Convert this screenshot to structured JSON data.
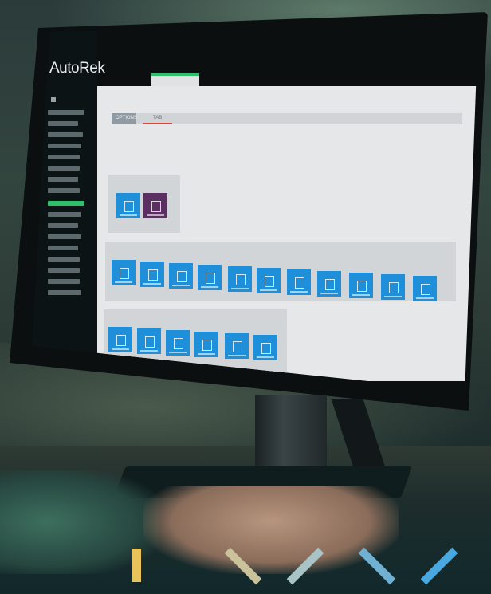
{
  "photo": {
    "description_colors": {
      "screen_bg": "#e5e7e8",
      "sidebar_bg": "#0c1314",
      "accent_green": "#2dbf6a",
      "tile_blue": "#1e8fd8",
      "tile_purple": "#5b2f62"
    }
  },
  "app": {
    "logo_text": "AutoRek",
    "toolbar": {
      "button_label": "OPTIONS",
      "tab_label": "TAB"
    }
  },
  "decor": {
    "stripe_colors": [
      "#e8c25b",
      "#c9c29a",
      "#a9c4c6",
      "#6fb0d3",
      "#4aa8e0"
    ]
  }
}
